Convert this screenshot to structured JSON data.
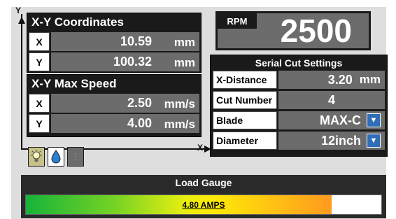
{
  "axes": {
    "y_label": "Y",
    "x_label": "X"
  },
  "xy_coordinates": {
    "title": "X-Y Coordinates",
    "rows": [
      {
        "label": "X",
        "value": "10.59",
        "unit": "mm"
      },
      {
        "label": "Y",
        "value": "100.32",
        "unit": "mm"
      }
    ]
  },
  "xy_max_speed": {
    "title": "X-Y Max Speed",
    "rows": [
      {
        "label": "X",
        "value": "2.50",
        "unit": "mm/s"
      },
      {
        "label": "Y",
        "value": "4.00",
        "unit": "mm/s"
      }
    ]
  },
  "rpm": {
    "label": "RPM",
    "value": "2500"
  },
  "serial_cut": {
    "title": "Serial Cut Settings",
    "x_distance": {
      "label": "X-Distance",
      "value": "3.20",
      "unit": "mm"
    },
    "cut_number": {
      "label": "Cut Number",
      "value": "4"
    },
    "blade": {
      "label": "Blade",
      "value": "MAX-C"
    },
    "diameter": {
      "label": "Diameter",
      "value": "12inch"
    }
  },
  "tools": [
    {
      "name": "light-bulb-icon",
      "state": "active"
    },
    {
      "name": "water-drop-icon",
      "state": "active"
    },
    {
      "name": "coolant-icon",
      "state": "inactive"
    }
  ],
  "load_gauge": {
    "title": "Load Gauge",
    "reading": "4.80 AMPS",
    "fill_fraction": 0.86
  }
}
